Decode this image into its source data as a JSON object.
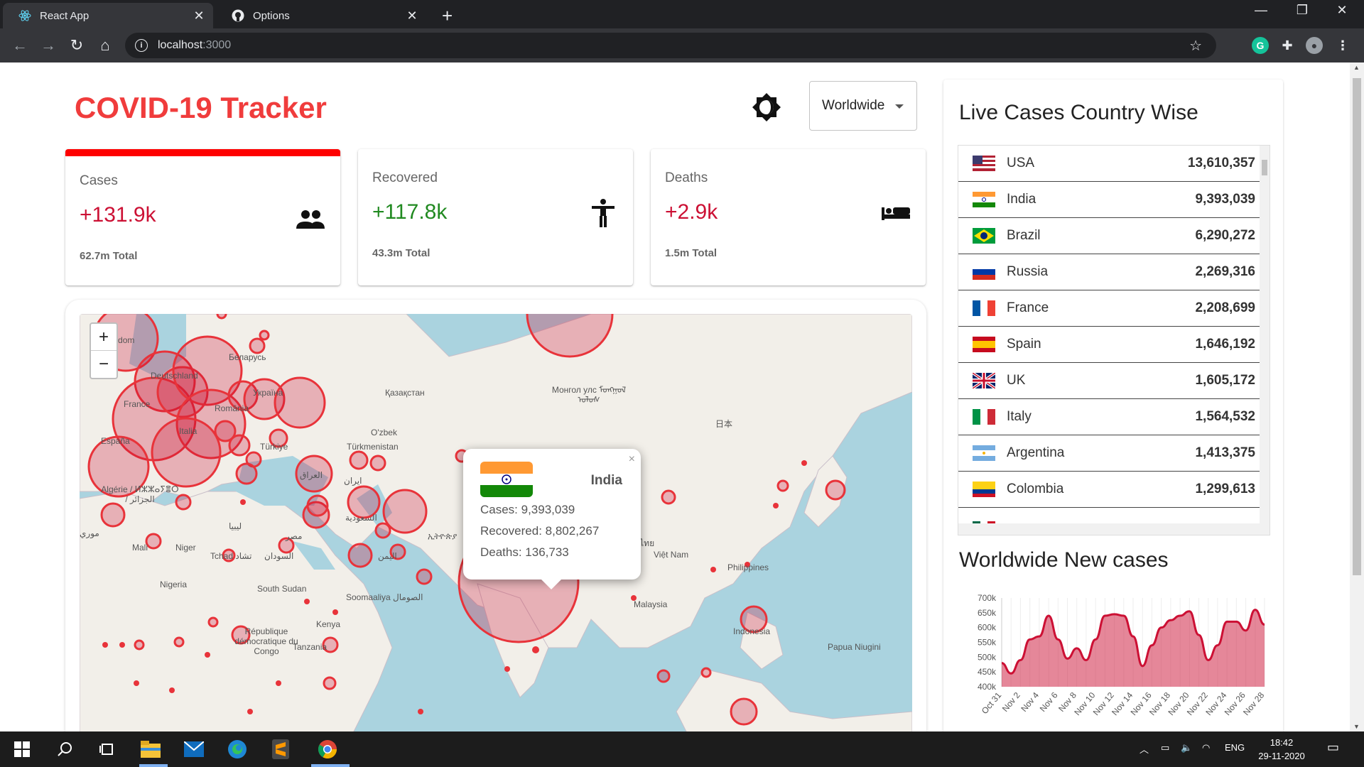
{
  "browser": {
    "tabs": [
      {
        "title": "React App",
        "favicon": "react-icon",
        "active": true
      },
      {
        "title": "Options",
        "favicon": "github-icon",
        "active": false
      }
    ],
    "url_host": "localhost",
    "url_port": ":3000"
  },
  "app": {
    "title": "COVID-19 Tracker",
    "selected_country": "Worldwide",
    "theme_toggle_icon": "brightness-icon"
  },
  "infoboxes": [
    {
      "label": "Cases",
      "value": "+131.9k",
      "total": "62.7m Total",
      "icon": "people-icon",
      "color": "#cc1034",
      "selected": true
    },
    {
      "label": "Recovered",
      "value": "+117.8k",
      "total": "43.3m Total",
      "icon": "accessibility-icon",
      "color": "#218a21",
      "selected": false
    },
    {
      "label": "Deaths",
      "value": "+2.9k",
      "total": "1.5m Total",
      "icon": "hotel-bed-icon",
      "color": "#cc1034",
      "selected": false
    }
  ],
  "map": {
    "zoom_in": "+",
    "zoom_out": "−",
    "labels": [
      "Kingdom",
      "Deutschland",
      "France",
      "España",
      "Italia",
      "România",
      "Україна",
      "Беларусь",
      "Türkiye",
      "Қазақстан",
      "O'zbek",
      "Türkmenistan",
      "Монгол улс ᠮᠣᠩᠭᠣᠯ ᠤᠯᠤᠰ",
      "日本",
      "العراق",
      "ایران",
      "Algérie / ⵍⵣⵣⴰⵢⴻⵔ / الجزائر",
      "ليبيا",
      "مصر",
      "Mali",
      "Niger",
      "Tchad تشاد",
      "السودان",
      "Nigeria",
      "South Sudan",
      "Soomaaliya الصومال",
      "Kenya",
      "République démocratique du Congo",
      "Tanzania",
      "Việt Nam",
      "Philippines",
      "Malaysia",
      "Indonesia",
      "Papua Niugini",
      "ประเทศไทย",
      "اليمن",
      "السعودية",
      "ኢትዮጵያ",
      "موري"
    ],
    "popup": {
      "country": "India",
      "cases": "Cases: 9,393,039",
      "recovered": "Recovered: 8,802,267",
      "deaths": "Deaths: 136,733",
      "close": "×"
    }
  },
  "sidebar": {
    "table_title": "Live Cases Country Wise",
    "countries": [
      {
        "name": "USA",
        "cases": "13,610,357",
        "flag": "us-flag-icon"
      },
      {
        "name": "India",
        "cases": "9,393,039",
        "flag": "in-flag-icon"
      },
      {
        "name": "Brazil",
        "cases": "6,290,272",
        "flag": "br-flag-icon"
      },
      {
        "name": "Russia",
        "cases": "2,269,316",
        "flag": "ru-flag-icon"
      },
      {
        "name": "France",
        "cases": "2,208,699",
        "flag": "fr-flag-icon"
      },
      {
        "name": "Spain",
        "cases": "1,646,192",
        "flag": "es-flag-icon"
      },
      {
        "name": "UK",
        "cases": "1,605,172",
        "flag": "gb-flag-icon"
      },
      {
        "name": "Italy",
        "cases": "1,564,532",
        "flag": "it-flag-icon"
      },
      {
        "name": "Argentina",
        "cases": "1,413,375",
        "flag": "ar-flag-icon"
      },
      {
        "name": "Colombia",
        "cases": "1,299,613",
        "flag": "co-flag-icon"
      }
    ],
    "chart_title": "Worldwide New cases"
  },
  "chart_data": {
    "type": "area",
    "title": "Worldwide New cases",
    "xlabel": "",
    "ylabel": "",
    "ylim": [
      400000,
      700000
    ],
    "y_ticks": [
      "700k",
      "650k",
      "600k",
      "550k",
      "500k",
      "450k",
      "400k"
    ],
    "x_ticks": [
      "Oct 31",
      "Nov 2",
      "Nov 4",
      "Nov 6",
      "Nov 8",
      "Nov 10",
      "Nov 12",
      "Nov 14",
      "Nov 16",
      "Nov 18",
      "Nov 20",
      "Nov 22",
      "Nov 24",
      "Nov 26",
      "Nov 28"
    ],
    "x": [
      "Oct 31",
      "Nov 1",
      "Nov 2",
      "Nov 3",
      "Nov 4",
      "Nov 5",
      "Nov 6",
      "Nov 7",
      "Nov 8",
      "Nov 9",
      "Nov 10",
      "Nov 11",
      "Nov 12",
      "Nov 13",
      "Nov 14",
      "Nov 15",
      "Nov 16",
      "Nov 17",
      "Nov 18",
      "Nov 19",
      "Nov 20",
      "Nov 21",
      "Nov 22",
      "Nov 23",
      "Nov 24",
      "Nov 25",
      "Nov 26",
      "Nov 27",
      "Nov 28"
    ],
    "series": [
      {
        "values": [
          480000,
          445000,
          490000,
          560000,
          570000,
          640000,
          560000,
          495000,
          530000,
          490000,
          560000,
          640000,
          645000,
          640000,
          570000,
          470000,
          540000,
          600000,
          625000,
          640000,
          655000,
          575000,
          490000,
          540000,
          620000,
          620000,
          590000,
          660000,
          610000
        ]
      }
    ],
    "color": "#cc1034",
    "fill": "rgba(204,16,52,0.5)"
  },
  "taskbar": {
    "apps": [
      "windows-start-icon",
      "search-icon",
      "task-view-icon",
      "file-explorer-icon",
      "mail-icon",
      "edge-icon",
      "sublime-text-icon",
      "chrome-icon"
    ],
    "language": "ENG",
    "time": "18:42",
    "date": "29-11-2020"
  }
}
